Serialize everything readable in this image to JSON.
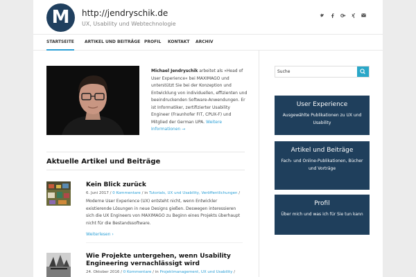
{
  "site": {
    "url": "http://jendryschik.de",
    "tagline": "UX, Usability und Webtechnologie",
    "logo_letter": "M"
  },
  "social": [
    "twitter-icon",
    "facebook-icon",
    "google-plus-icon",
    "xing-icon",
    "mail-icon"
  ],
  "nav": [
    "STARTSEITE",
    "ARTIKEL UND BEITRÄGE",
    "PROFIL",
    "KONTAKT",
    "ARCHIV"
  ],
  "intro": {
    "name": "Michael Jendryschik",
    "text": " arbeitet als »Head of User Experience« bei MAXIMAGO und unterstützt Sie bei der Konzeption und Entwicklung von individuellen, effizienten und beeindruckenden Software-Anwendungen. Er ist Informatiker, zertifizierter Usability Engineer (Fraunhofer FIT, CPUX-F) und Mitglied der German UPA. ",
    "link": "Weitere Informationen →"
  },
  "section_title": "Aktuelle Artikel und Beiträge",
  "posts": [
    {
      "title": "Kein Blick zurück",
      "date": "6. Juni 2017",
      "comments": "0 Kommentare",
      "in": "in",
      "categories": "Tutorials, UX und Usability, Veröffentlichungen",
      "excerpt": "Moderne User Experience (UX) entsteht nicht, wenn Entwickler existierende Lösungen in neue Designs gießen. Deswegen interessieren sich die UX Engineers von MAXIMAGO zu Beginn eines Projekts überhaupt nicht für die Bestandssoftware.",
      "read_more": "Weiterlesen ›"
    },
    {
      "title": "Wie Projekte untergehen, wenn Usability Engineering vernachlässigt wird",
      "date": "24. Oktober 2016",
      "comments": "0 Kommentare",
      "in": "in",
      "categories": "Projektmanagement, UX und Usability"
    }
  ],
  "sidebar": {
    "search_placeholder": "Suche",
    "ctas": [
      {
        "title": "User Experience",
        "sub": "Ausgewählte Publikationen zu UX und Usability"
      },
      {
        "title": "Artikel und Beiträge",
        "sub": "Fach- und Online-Publikationen, Bücher und Vorträge"
      },
      {
        "title": "Profil",
        "sub": "Über mich und was ich für Sie tun kann"
      }
    ]
  },
  "colors": {
    "accent": "#2a9fd6",
    "cta_bg": "#1f3f5c",
    "logo_bg": "#20405f"
  }
}
